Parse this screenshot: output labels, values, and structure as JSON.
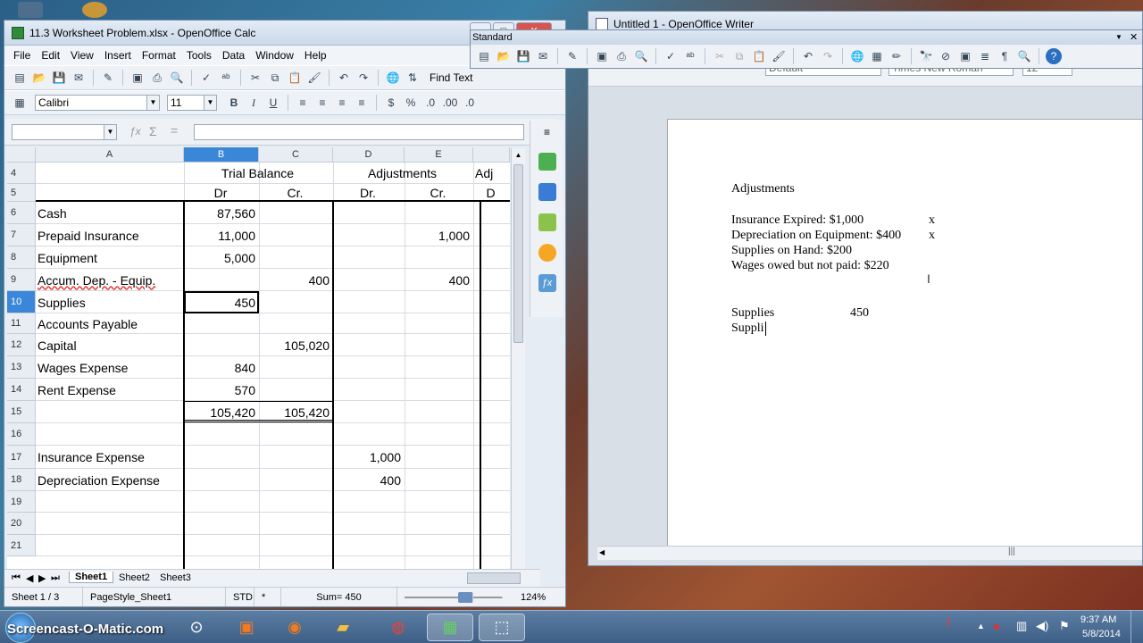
{
  "calc": {
    "title": "11.3 Worksheet Problem.xlsx - OpenOffice Calc",
    "menu": [
      "File",
      "Edit",
      "View",
      "Insert",
      "Format",
      "Tools",
      "Data",
      "Window",
      "Help"
    ],
    "find_text": "Find Text",
    "font_name": "Calibri",
    "font_size": "11",
    "formula_symbols": {
      "sum": "Σ",
      "equals": "="
    },
    "columns": [
      "A",
      "B",
      "C",
      "D",
      "E"
    ],
    "rows": [
      {
        "n": "4",
        "a": "",
        "b": "Trial Balance",
        "c": "",
        "d": "Adjustments",
        "e": "",
        "f": "Adj"
      },
      {
        "n": "5",
        "a": "",
        "b": "Dr",
        "c": "Cr.",
        "d": "Dr.",
        "e": "Cr.",
        "f": "D"
      },
      {
        "n": "6",
        "a": "Cash",
        "b": "87,560",
        "c": "",
        "d": "",
        "e": ""
      },
      {
        "n": "7",
        "a": "Prepaid Insurance",
        "b": "11,000",
        "c": "",
        "d": "",
        "e": "1,000"
      },
      {
        "n": "8",
        "a": "Equipment",
        "b": "5,000",
        "c": "",
        "d": "",
        "e": ""
      },
      {
        "n": "9",
        "a": "Accum. Dep. - Equip.",
        "b": "",
        "c": "400",
        "d": "",
        "e": "400"
      },
      {
        "n": "10",
        "a": "Supplies",
        "b": "450",
        "c": "",
        "d": "",
        "e": ""
      },
      {
        "n": "11",
        "a": "Accounts Payable",
        "b": "",
        "c": "",
        "d": "",
        "e": ""
      },
      {
        "n": "12",
        "a": "Capital",
        "b": "",
        "c": "105,020",
        "d": "",
        "e": ""
      },
      {
        "n": "13",
        "a": "Wages Expense",
        "b": "840",
        "c": "",
        "d": "",
        "e": ""
      },
      {
        "n": "14",
        "a": "Rent Expense",
        "b": "570",
        "c": "",
        "d": "",
        "e": ""
      },
      {
        "n": "15",
        "a": "",
        "b": "105,420",
        "c": "105,420",
        "d": "",
        "e": ""
      },
      {
        "n": "16",
        "a": "",
        "b": "",
        "c": "",
        "d": "",
        "e": ""
      },
      {
        "n": "17",
        "a": "Insurance Expense",
        "b": "",
        "c": "",
        "d": "1,000",
        "e": ""
      },
      {
        "n": "18",
        "a": "Depreciation Expense",
        "b": "",
        "c": "",
        "d": "400",
        "e": ""
      },
      {
        "n": "19",
        "a": "",
        "b": "",
        "c": "",
        "d": "",
        "e": ""
      },
      {
        "n": "20",
        "a": "",
        "b": "",
        "c": "",
        "d": "",
        "e": ""
      },
      {
        "n": "21",
        "a": "",
        "b": "",
        "c": "",
        "d": "",
        "e": ""
      }
    ],
    "sheets": [
      "Sheet1",
      "Sheet2",
      "Sheet3"
    ],
    "status": {
      "sheet": "Sheet 1 / 3",
      "pagestyle": "PageStyle_Sheet1",
      "mode": "STD",
      "star": "*",
      "sum": "Sum= 450",
      "zoom": "124%"
    }
  },
  "writer": {
    "title": "Untitled 1 - OpenOffice Writer",
    "toolbar_title": "Standard",
    "style_value": "Default",
    "font_value": "Times New Roman",
    "size_value": "12",
    "doc_lines": [
      "Adjustments",
      "Insurance Expired: $1,000",
      "Depreciation on Equipment: $400",
      "Supplies on Hand: $200",
      "Wages owed but not paid: $220",
      "Supplies",
      "Suppli"
    ],
    "marks": [
      "x",
      "x"
    ],
    "supplies_value": "450"
  },
  "taskbar": {
    "brand": "Screencast-O-Matic.com",
    "time": "9:37 AM",
    "date": "5/8/2014"
  }
}
